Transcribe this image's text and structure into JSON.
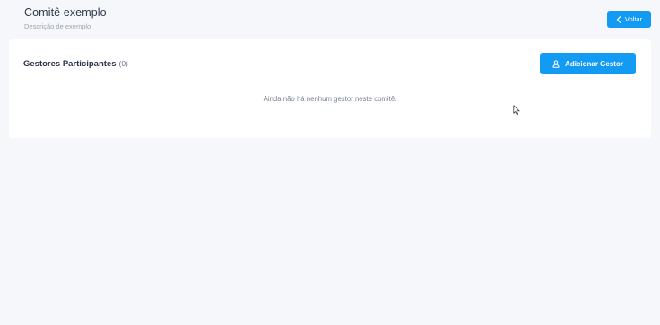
{
  "header": {
    "title": "Comitê exemplo",
    "subtitle": "Descrição de exemplo",
    "back_label": "Voltar",
    "back_icon": "chevron-left-icon"
  },
  "section": {
    "title": "Gestores Participantes",
    "count": "(0)",
    "add_label": "Adicionar Gestor",
    "add_icon": "user-icon",
    "empty_message": "Ainda não há nenhum gestor neste comitê."
  },
  "colors": {
    "accent": "#139af2",
    "background": "#f5f7fa",
    "card": "#ffffff"
  }
}
